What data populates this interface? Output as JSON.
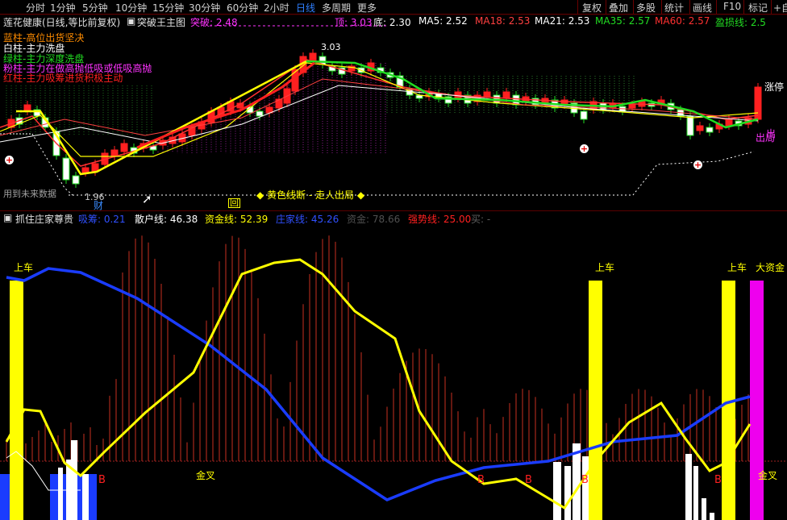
{
  "toolbar": {
    "periods": [
      "分时",
      "1分钟",
      "5分钟",
      "10分钟",
      "15分钟",
      "30分钟",
      "60分钟",
      "2小时",
      "日线",
      "多周期",
      "更多"
    ],
    "active": "日线",
    "right": [
      "复权",
      "叠加",
      "多股",
      "统计",
      "画线",
      "F10",
      "标记",
      "+自"
    ]
  },
  "upper": {
    "title": "莲花健康(日线,等比前复权)",
    "indicator_name": "突破王主图",
    "tupo_label": "突破: 2.48",
    "ding_label": "顶: 3.03",
    "di_label": "底: 2.30",
    "ma": [
      {
        "label": "MA5: 2.52",
        "color": "#ffffff"
      },
      {
        "label": "MA18: 2.53",
        "color": "#ff4040"
      },
      {
        "label": "MA21: 2.53",
        "color": "#ffffff"
      },
      {
        "label": "MA35: 2.57",
        "color": "#22dd22"
      },
      {
        "label": "MA60: 2.57",
        "color": "#ff3030"
      },
      {
        "label": "盈损线: 2.5",
        "color": "#22dd22"
      }
    ],
    "legend": [
      {
        "text": "蓝柱-高位出货坚决",
        "color": "#ff8c00"
      },
      {
        "text": "白柱-主力洗盘",
        "color": "#ffffff"
      },
      {
        "text": "绿柱-主力深度洗盘",
        "color": "#22dd22"
      },
      {
        "text": "粉柱-主力在做高抛低吸或低吸高抛",
        "color": "#ff33ff"
      },
      {
        "text": "红柱-主力吸筹进货积极主动",
        "color": "#ff2020"
      }
    ],
    "peak_label": "3.03",
    "low_label": "1.96",
    "cai_label": "财",
    "hui_label": "回",
    "future_label": "用到未来数据",
    "banner": "◆ 黄色线断 - 走人出局 ◆",
    "zhangting": "涨停",
    "chu_label": "出",
    "chuju_label": "出局"
  },
  "lower": {
    "name": "抓住庄家尊贵",
    "stats": [
      {
        "label": "吸筹: 0.21",
        "color": "#3050ff"
      },
      {
        "label": "散户线: 46.38",
        "color": "#ffffff"
      },
      {
        "label": "资金线: 52.39",
        "color": "#ffff00"
      },
      {
        "label": "庄家线: 45.26",
        "color": "#3050ff"
      },
      {
        "label": "资金: 78.66",
        "color": "#505050"
      },
      {
        "label": "强势线: 25.00",
        "color": "#ff2020"
      },
      {
        "label": "买: -",
        "color": "#606060"
      }
    ],
    "shangche": [
      "上车",
      "上车",
      "上车"
    ],
    "dazijin": "大资金",
    "jincha": [
      "金叉",
      "金叉"
    ],
    "b_marks": [
      "B",
      "B",
      "B",
      "B",
      "B"
    ]
  },
  "colors": {
    "rise": "#ff2020",
    "fall": "#22dd22",
    "yellow": "#ffff00",
    "blue": "#1a3cff",
    "magenta": "#ee00ee"
  }
}
